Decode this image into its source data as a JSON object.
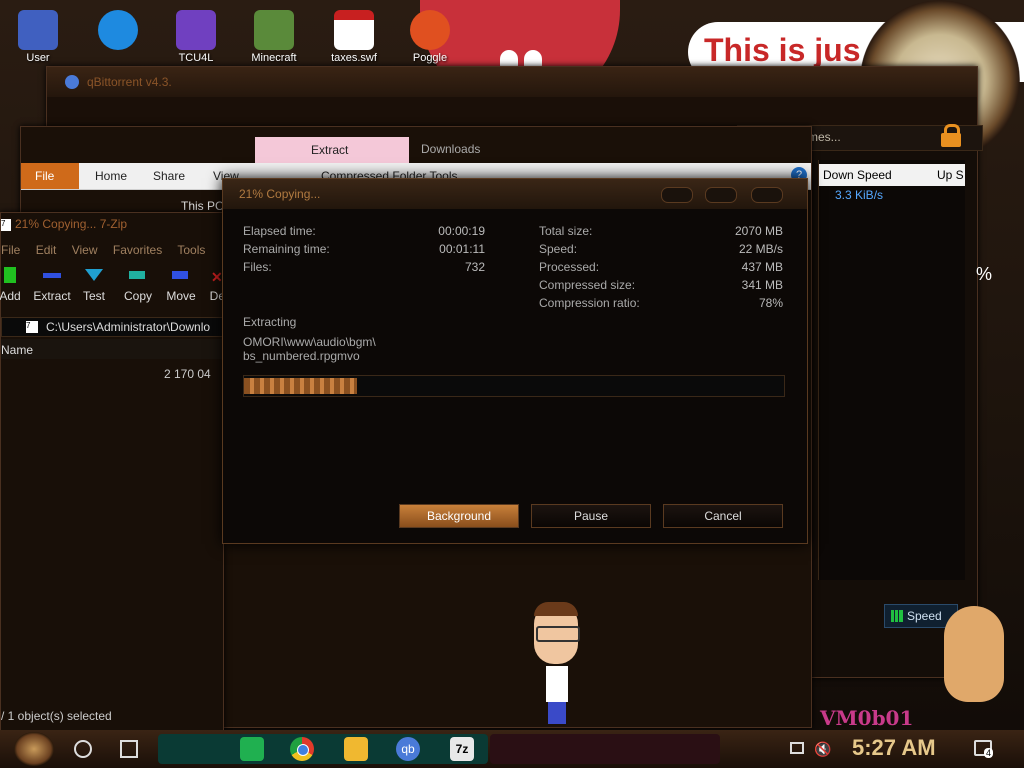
{
  "desktop": {
    "icons": [
      {
        "label": "User",
        "color": "#4060c0"
      },
      {
        "label": "",
        "color": "#1e8ae0"
      },
      {
        "label": "TCU4L",
        "color": "#7040c0"
      },
      {
        "label": "Minecraft",
        "color": "#5a8a3a"
      },
      {
        "label": "taxes.swf",
        "color": "#c82020"
      },
      {
        "label": "Poggle",
        "color": "#e05020"
      }
    ],
    "speech_text": "This is jus",
    "vm_label": "VM0b01"
  },
  "qbittorrent": {
    "title": "qBittorrent v4.3.",
    "search_placeholder": "t names...",
    "columns": [
      "Down Speed",
      "Up S"
    ],
    "down_speed_value": "3.3 KiB/s",
    "speed_button": "Speed",
    "percent_fragment": "%"
  },
  "explorer": {
    "context_tab": "Extract",
    "context_tab_secondary": "Downloads",
    "tabs": [
      "File",
      "Home",
      "Share",
      "View",
      "Compressed Folder Tools"
    ],
    "location": "This PC",
    "help": "?"
  },
  "sevenzip": {
    "title": "21% Copying... 7-Zip",
    "menu": [
      "File",
      "Edit",
      "View",
      "Favorites",
      "Tools"
    ],
    "toolbar": [
      {
        "label": "Add",
        "color": "#20c020"
      },
      {
        "label": "Extract",
        "color": "#3050e0"
      },
      {
        "label": "Test",
        "color": "#20a0d0"
      },
      {
        "label": "Copy",
        "color": "#20b0a0"
      },
      {
        "label": "Move",
        "color": "#3050e0"
      },
      {
        "label": "Dele",
        "color": "#d02020"
      }
    ],
    "path": "C:\\Users\\Administrator\\Downlo",
    "column_name": "Name",
    "size_value": "2 170 04",
    "status": "/ 1 object(s) selected"
  },
  "copy_dialog": {
    "title": "21% Copying...",
    "left_stats": [
      {
        "label": "Elapsed time:",
        "value": "00:00:19"
      },
      {
        "label": "Remaining time:",
        "value": "00:01:11"
      },
      {
        "label": "Files:",
        "value": "732"
      }
    ],
    "right_stats": [
      {
        "label": "Total size:",
        "value": "2070 MB"
      },
      {
        "label": "Speed:",
        "value": "22 MB/s"
      },
      {
        "label": "Processed:",
        "value": "437 MB"
      },
      {
        "label": "Compressed size:",
        "value": "341 MB"
      },
      {
        "label": "Compression ratio:",
        "value": "78%"
      }
    ],
    "action": "Extracting",
    "file_path_line1": "OMORI\\www\\audio\\bgm\\",
    "file_path_line2": "bs_numbered.rpgmvo",
    "progress": 0.21,
    "buttons": {
      "background": "Background",
      "pause": "Pause",
      "cancel": "Cancel"
    }
  },
  "taskbar": {
    "time": "5:27 AM",
    "notification_count": "4",
    "apps": [
      "notes",
      "chrome",
      "file-explorer",
      "qbittorrent",
      "7-zip"
    ],
    "qb_label": "qb",
    "zip_label": "7z"
  }
}
